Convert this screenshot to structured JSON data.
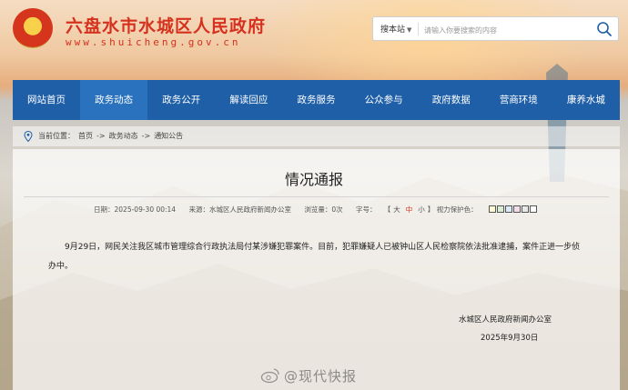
{
  "site": {
    "title": "六盘水市水城区人民政府",
    "domain": "www.shuicheng.gov.cn"
  },
  "search": {
    "scope_label": "搜本站",
    "placeholder": "请输入你要搜索的内容"
  },
  "nav": {
    "items": [
      {
        "label": "网站首页"
      },
      {
        "label": "政务动态"
      },
      {
        "label": "政务公开"
      },
      {
        "label": "解读回应"
      },
      {
        "label": "政务服务"
      },
      {
        "label": "公众参与"
      },
      {
        "label": "政府数据"
      },
      {
        "label": "营商环境"
      },
      {
        "label": "康养水城"
      }
    ],
    "active_index": 1
  },
  "breadcrumb": {
    "prefix": "当前位置：",
    "items": [
      "首页",
      "->",
      "政务动态",
      "->",
      "通知公告"
    ]
  },
  "article": {
    "title": "情况通报",
    "date": "日期：2025-09-30 00:14",
    "source": "来源：水城区人民政府新闻办公室",
    "views": "浏览量：0次",
    "font_size_label": "字号：",
    "font_sizes": [
      "大",
      "中",
      "小"
    ],
    "protect_label": "视力保护色：",
    "swatch_colors": [
      "#fdf7d6",
      "#d9eed2",
      "#dbe8f5",
      "#f3dcea",
      "#e8e8e8",
      "#ffffff"
    ],
    "body": "9月29日，网民关注我区城市管理综合行政执法局付某涉嫌犯罪案件。目前，犯罪嫌疑人已被钟山区人民检察院依法批准逮捕，案件正进一步侦办中。",
    "signature_org": "水城区人民政府新闻办公室",
    "signature_date": "2025年9月30日"
  },
  "watermark": {
    "text": "@现代快报"
  },
  "colors": {
    "brand_red": "#d6311e",
    "nav_blue": "#1f5fa8",
    "nav_active": "#2a72bd"
  }
}
